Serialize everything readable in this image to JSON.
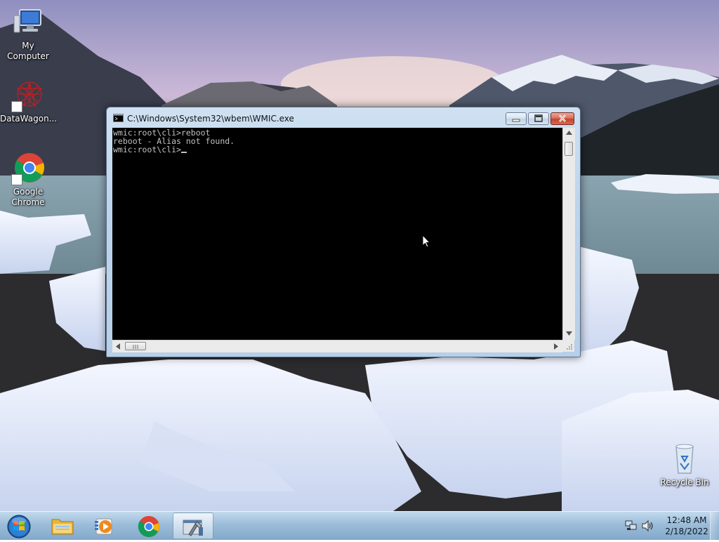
{
  "desktop": {
    "icons": [
      {
        "label": "My Computer"
      },
      {
        "label": "DataWagon..."
      },
      {
        "label": "Google Chrome"
      },
      {
        "label": "Recycle Bin"
      }
    ]
  },
  "window": {
    "title": "C:\\Windows\\System32\\wbem\\WMIC.exe",
    "console_lines": [
      "wmic:root\\cli>reboot",
      "reboot - Alias not found.",
      "wmic:root\\cli>"
    ],
    "controls": {
      "minimize": "minimize",
      "maximize": "maximize",
      "close": "close"
    }
  },
  "taskbar": {
    "pinned": [
      "start-orb",
      "file-explorer",
      "media-player",
      "google-chrome",
      "wmic-console"
    ],
    "clock": {
      "time": "12:48 AM",
      "date": "2/18/2022"
    }
  },
  "colors": {
    "console_bg": "#000000",
    "console_fg": "#c0c0c0",
    "close_button": "#c6432a"
  }
}
